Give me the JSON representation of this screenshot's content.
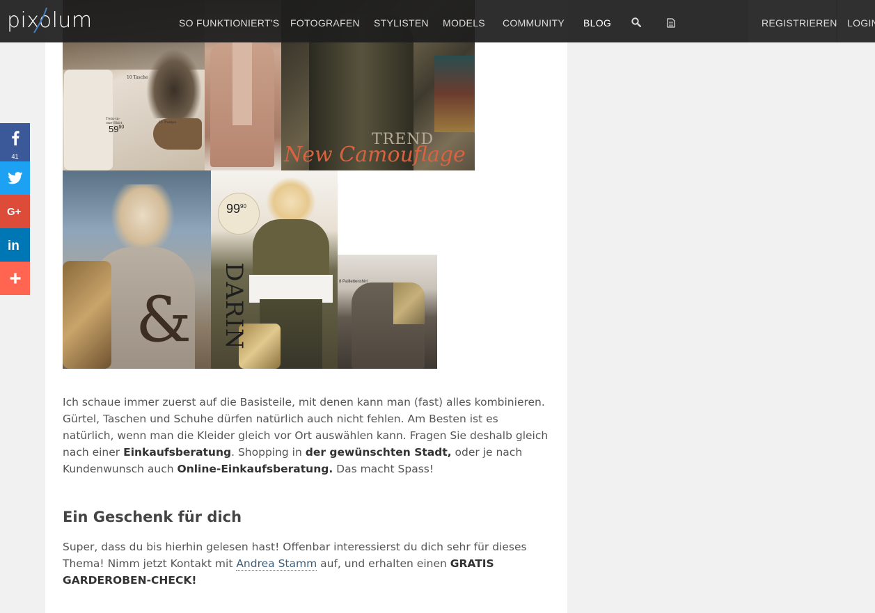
{
  "brand": {
    "logo_text": "pixolum"
  },
  "nav": {
    "items": [
      "SO FUNKTIONIERT'S",
      "FOTOGRAFEN",
      "STYLISTEN",
      "MODELS",
      "COMMUNITY",
      "BLOG"
    ],
    "register": "REGISTRIEREN",
    "login": "LOGIN",
    "search_icon": "search-icon",
    "page_icon": "document-icon"
  },
  "social": {
    "facebook": {
      "icon": "facebook-icon",
      "count": "41",
      "color": "#3b5998"
    },
    "twitter": {
      "icon": "twitter-icon",
      "color": "#1da1f2"
    },
    "googleplus": {
      "icon": "google-plus-icon",
      "color": "#dd4b39"
    },
    "linkedin": {
      "icon": "linkedin-icon",
      "color": "#0077b5"
    },
    "more": {
      "icon": "plus-icon",
      "color": "#ff6550"
    }
  },
  "collage": {
    "labels": {
      "tasche": "10 Tasche",
      "shirt": "Twin-in-one-Shirt",
      "shirt_price": "59",
      "shirt_cents": "90",
      "pumps": "11 Pumps",
      "trend": "TREND",
      "camouflage": "New Camouflage",
      "sticker_price": "99",
      "sticker_cents": "90",
      "darin": "DARIN",
      "pailletten": "8 Paillettenshirt"
    }
  },
  "article": {
    "p1_a": "Ich schaue immer zuerst auf die Basisteile, mit denen kann man (fast) alles kombinieren. Gürtel, Taschen und Schuhe dürfen natürlich auch nicht fehlen. Am Besten ist es natürlich, wenn man die Kleider gleich vor Ort auswählen kann. Fragen Sie deshalb gleich nach einer ",
    "p1_b1": "Einkaufsberatung",
    "p1_c": ". Shopping in ",
    "p1_b2": "der gewünschten Stadt,",
    "p1_d": " oder je nach Kundenwunsch auch ",
    "p1_b3": "Online-Einkaufsberatung.",
    "p1_e": " Das macht Spass!",
    "heading": "Ein Geschenk für dich",
    "p2_a": "Super, dass du bis hierhin gelesen hast! Offenbar interessierst du dich sehr für dieses Thema! Nimm jetzt Kontakt mit ",
    "p2_link": "Andrea Stamm",
    "p2_b": " auf, und erhalten einen ",
    "p2_bold": "GRATIS GARDEROBEN-CHECK!"
  }
}
